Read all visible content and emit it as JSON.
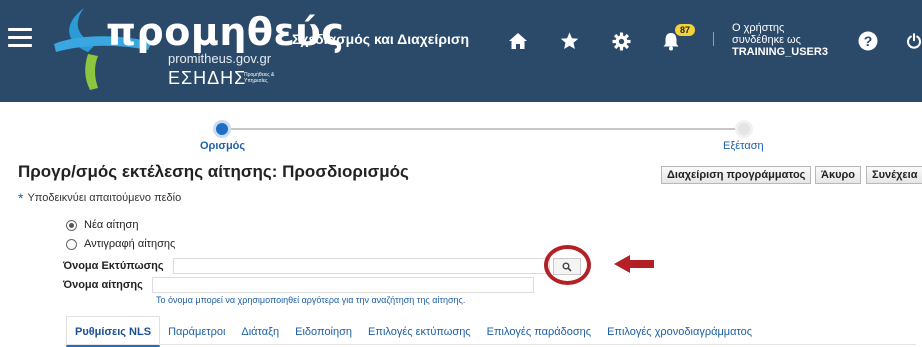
{
  "header": {
    "logo_title": "προμηθεύς",
    "logo_url": "promitheus.gov.gr",
    "logo_esidis": "ΕΣΗΔΗΣ",
    "logo_esidis_sub": "Προμήθειες & Υπηρεσίες",
    "app_title": "Σχεδιασμός και Διαχείριση",
    "notification_count": "87",
    "user_line1": "Ο χρήστης",
    "user_line2": "συνδέθηκε ως",
    "username": "TRAINING_USER3",
    "icons": [
      "menu-icon",
      "home-icon",
      "star-icon",
      "gear-icon",
      "bell-icon",
      "help-icon",
      "power-icon"
    ],
    "bg_color": "#2b4a6a"
  },
  "train": {
    "steps": [
      {
        "label": "Ορισμός",
        "active": true
      },
      {
        "label": "Εξέταση",
        "active": false
      }
    ]
  },
  "page": {
    "title": "Προγρ/σμός εκτέλεσης αίτησης: Προσδιορισμός",
    "buttons": {
      "schedule": "Διαχείριση προγράμματος",
      "cancel": "Άκυρο",
      "continue": "Συνέχεια"
    },
    "required_note": "Υποδεικνύει απαιτούμενο πεδίο"
  },
  "form": {
    "radio_new": {
      "label": "Νέα αίτηση",
      "selected": true
    },
    "radio_copy": {
      "label": "Αντιγραφή αίτησης",
      "selected": false
    },
    "print_name_label": "Όνομα Εκτύπωσης",
    "print_name_value": "",
    "request_name_label": "Όνομα αίτησης",
    "request_name_value": "",
    "request_name_hint": "Το όνομα μπορεί να χρησιμοποιηθεί αργότερα για την αναζήτηση της αίτησης.",
    "search_icon": "search-icon",
    "highlight_color": "#b32025"
  },
  "tabs": [
    {
      "label": "Ρυθμίσεις NLS",
      "active": true
    },
    {
      "label": "Παράμετροι",
      "active": false
    },
    {
      "label": "Διάταξη",
      "active": false
    },
    {
      "label": "Ειδοποίηση",
      "active": false
    },
    {
      "label": "Επιλογές εκτύπωσης",
      "active": false
    },
    {
      "label": "Επιλογές παράδοσης",
      "active": false
    },
    {
      "label": "Επιλογές χρονοδιαγράμματος",
      "active": false
    }
  ]
}
